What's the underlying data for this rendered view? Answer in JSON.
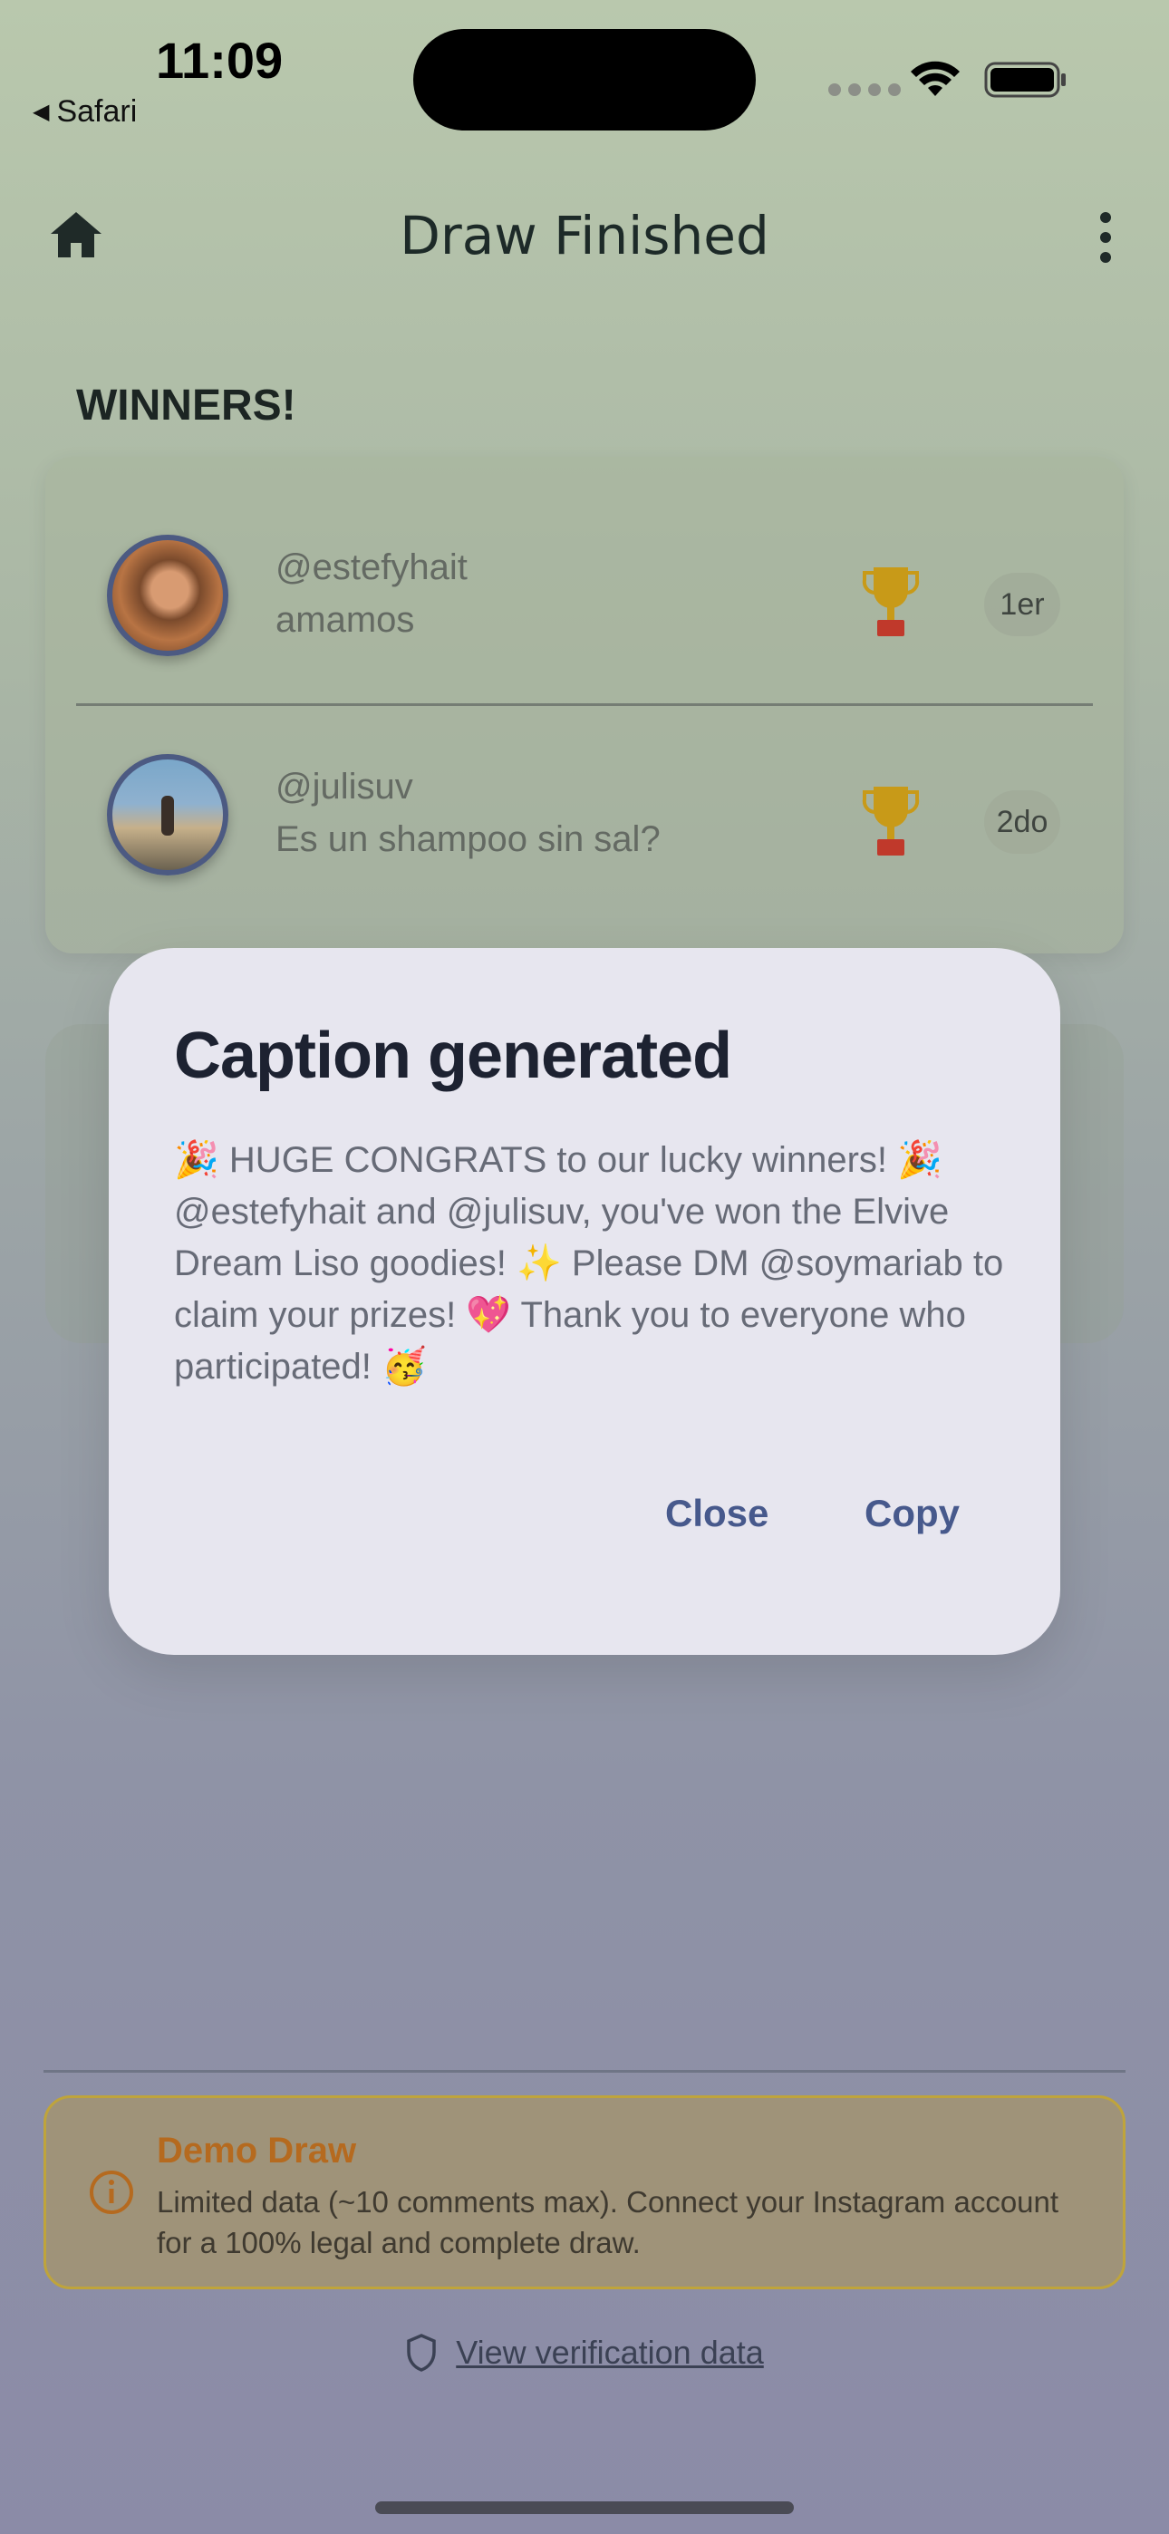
{
  "status_bar": {
    "time": "11:09",
    "back_app": "Safari"
  },
  "app_bar": {
    "title": "Draw Finished",
    "home_icon": "home-icon",
    "menu_icon": "more-vertical-icon"
  },
  "winners": {
    "heading": "WINNERS!",
    "items": [
      {
        "handle": "@estefyhait",
        "comment": "amamos",
        "rank": "1er",
        "icon": "trophy-icon"
      },
      {
        "handle": "@julisuv",
        "comment": "Es un shampoo sin sal?",
        "rank": "2do",
        "icon": "trophy-icon"
      }
    ]
  },
  "dialog": {
    "title": "Caption generated",
    "body": "🎉 HUGE CONGRATS to our lucky winners! 🎉 @estefyhait and @julisuv, you've won the Elvive Dream Liso goodies! ✨ Please DM @soymariab to claim your prizes! 💖 Thank you to everyone who participated! 🥳",
    "close_label": "Close",
    "copy_label": "Copy"
  },
  "demo_banner": {
    "title": "Demo Draw",
    "text": "Limited data (~10 comments max). Connect your Instagram account for a 100% legal and complete draw.",
    "icon": "info-icon"
  },
  "verify_link": {
    "label": "View verification data",
    "icon": "shield-icon"
  },
  "colors": {
    "accent": "#47598c",
    "warning": "#b56a1f",
    "trophy": "#c89a18"
  }
}
